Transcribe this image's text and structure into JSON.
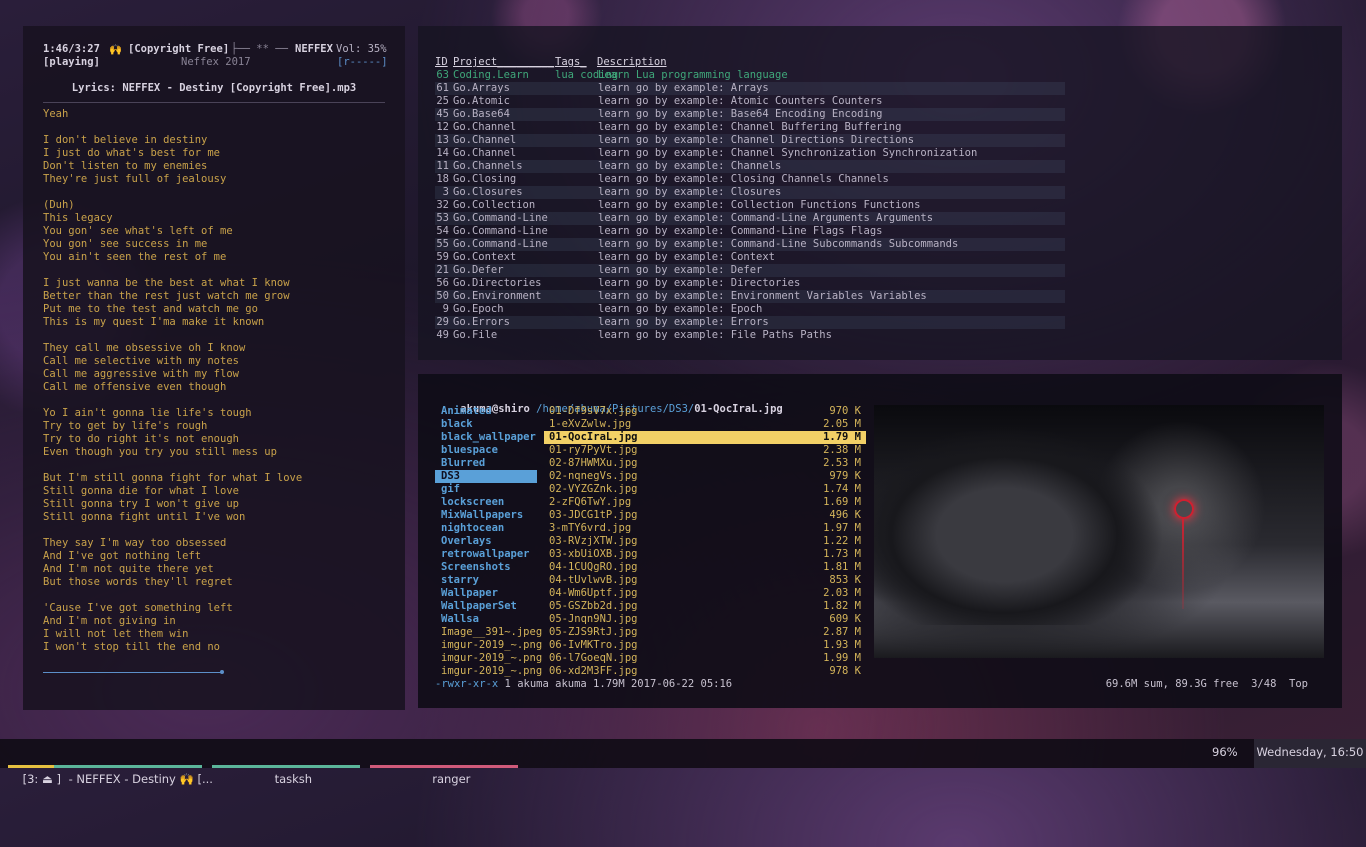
{
  "lyrics_panel": {
    "time": "1:46/3:27",
    "hands": "🙌",
    "title_short": "[Copyright Free]",
    "sep_glyphs": "├── ** ──",
    "artist": "NEFFEX",
    "volume": "Vol: 35%",
    "state": "[playing]",
    "album": "Neffex 2017",
    "flags": "[r-----]",
    "lyrics_title": "Lyrics: NEFFEX - Destiny [Copyright Free].mp3",
    "lines": [
      "Yeah",
      "",
      "I don't believe in destiny",
      "I just do what's best for me",
      "Don't listen to my enemies",
      "They're just full of jealousy",
      "",
      "(Duh)",
      "This legacy",
      "You gon' see what's left of me",
      "You gon' see success in me",
      "You ain't seen the rest of me",
      "",
      "I just wanna be the best at what I know",
      "Better than the rest just watch me grow",
      "Put me to the test and watch me go",
      "This is my quest I'ma make it known",
      "",
      "They call me obsessive oh I know",
      "Call me selective with my notes",
      "Call me aggressive with my flow",
      "Call me offensive even though",
      "",
      "Yo I ain't gonna lie life's tough",
      "Try to get by life's rough",
      "Try to do right it's not enough",
      "Even though you try you still mess up",
      "",
      "But I'm still gonna fight for what I love",
      "Still gonna die for what I love",
      "Still gonna try I won't give up",
      "Still gonna fight until I've won",
      "",
      "They say I'm way too obsessed",
      "And I've got nothing left",
      "And I'm not quite there yet",
      "But those words they'll regret",
      "",
      "'Cause I've got something left",
      "And I'm not giving in",
      "I will not let them win",
      "I won't stop till the end no"
    ]
  },
  "tasks": {
    "headers": {
      "id": "ID",
      "project": "Project",
      "tags": "Tags",
      "description": "Description"
    },
    "header_rules": {
      "project": "Project_________",
      "tags": "Tags_"
    },
    "rows": [
      {
        "id": "63",
        "project": "Coding.Learn",
        "tags": "lua coding",
        "description": "Learn Lua programming language"
      },
      {
        "id": "61",
        "project": "Go.Arrays",
        "tags": "",
        "description": "learn go by example: Arrays"
      },
      {
        "id": "25",
        "project": "Go.Atomic",
        "tags": "",
        "description": "learn go by example: Atomic Counters Counters"
      },
      {
        "id": "45",
        "project": "Go.Base64",
        "tags": "",
        "description": "learn go by example: Base64 Encoding Encoding"
      },
      {
        "id": "12",
        "project": "Go.Channel",
        "tags": "",
        "description": "learn go by example: Channel Buffering Buffering"
      },
      {
        "id": "13",
        "project": "Go.Channel",
        "tags": "",
        "description": "learn go by example: Channel Directions Directions"
      },
      {
        "id": "14",
        "project": "Go.Channel",
        "tags": "",
        "description": "learn go by example: Channel Synchronization Synchronization"
      },
      {
        "id": "11",
        "project": "Go.Channels",
        "tags": "",
        "description": "learn go by example: Channels"
      },
      {
        "id": "18",
        "project": "Go.Closing",
        "tags": "",
        "description": "learn go by example: Closing Channels Channels"
      },
      {
        "id": "3",
        "project": "Go.Closures",
        "tags": "",
        "description": "learn go by example: Closures"
      },
      {
        "id": "32",
        "project": "Go.Collection",
        "tags": "",
        "description": "learn go by example: Collection Functions Functions"
      },
      {
        "id": "53",
        "project": "Go.Command-Line",
        "tags": "",
        "description": "learn go by example: Command-Line Arguments Arguments"
      },
      {
        "id": "54",
        "project": "Go.Command-Line",
        "tags": "",
        "description": "learn go by example: Command-Line Flags Flags"
      },
      {
        "id": "55",
        "project": "Go.Command-Line",
        "tags": "",
        "description": "learn go by example: Command-Line Subcommands Subcommands"
      },
      {
        "id": "59",
        "project": "Go.Context",
        "tags": "",
        "description": "learn go by example: Context"
      },
      {
        "id": "21",
        "project": "Go.Defer",
        "tags": "",
        "description": "learn go by example: Defer"
      },
      {
        "id": "56",
        "project": "Go.Directories",
        "tags": "",
        "description": "learn go by example: Directories"
      },
      {
        "id": "50",
        "project": "Go.Environment",
        "tags": "",
        "description": "learn go by example: Environment Variables Variables"
      },
      {
        "id": "9",
        "project": "Go.Epoch",
        "tags": "",
        "description": "learn go by example: Epoch"
      },
      {
        "id": "29",
        "project": "Go.Errors",
        "tags": "",
        "description": "learn go by example: Errors"
      },
      {
        "id": "49",
        "project": "Go.File",
        "tags": "",
        "description": "learn go by example: File Paths Paths"
      }
    ]
  },
  "ranger": {
    "user": "akuma@shiro",
    "path": "/home/akuma/Pictures/DS3/",
    "current_file": "01-QocIraL.jpg",
    "dirs": [
      {
        "name": "Animated",
        "type": "dir"
      },
      {
        "name": "black",
        "type": "dir"
      },
      {
        "name": "black_wallpaper",
        "type": "dir"
      },
      {
        "name": "bluespace",
        "type": "dir"
      },
      {
        "name": "Blurred",
        "type": "dir"
      },
      {
        "name": "DS3",
        "type": "dir",
        "selected": true
      },
      {
        "name": "gif",
        "type": "dir"
      },
      {
        "name": "lockscreen",
        "type": "dir"
      },
      {
        "name": "MixWallpapers",
        "type": "dir"
      },
      {
        "name": "nightocean",
        "type": "dir"
      },
      {
        "name": "Overlays",
        "type": "dir"
      },
      {
        "name": "retrowallpaper",
        "type": "dir"
      },
      {
        "name": "Screenshots",
        "type": "dir"
      },
      {
        "name": "starry",
        "type": "dir"
      },
      {
        "name": "Wallpaper",
        "type": "dir"
      },
      {
        "name": "WallpaperSet",
        "type": "dir"
      },
      {
        "name": "Wallsa",
        "type": "dir"
      },
      {
        "name": "Image__391~.jpeg",
        "type": "file"
      },
      {
        "name": "imgur-2019_~.png",
        "type": "file"
      },
      {
        "name": "imgur-2019_~.png",
        "type": "file"
      },
      {
        "name": "imgur-2019_~.png",
        "type": "file"
      }
    ],
    "files": [
      {
        "name": "01-Df9sV7x.jpg",
        "size": "970 K"
      },
      {
        "name": "1-eXvZwlw.jpg",
        "size": "2.05 M"
      },
      {
        "name": "01-QocIraL.jpg",
        "size": "1.79 M",
        "selected": true
      },
      {
        "name": "01-ry7PyVt.jpg",
        "size": "2.38 M"
      },
      {
        "name": "02-87HWMXu.jpg",
        "size": "2.53 M"
      },
      {
        "name": "02-nqnegVs.jpg",
        "size": "979 K"
      },
      {
        "name": "02-VYZGZnk.jpg",
        "size": "1.74 M"
      },
      {
        "name": "2-zFQ6TwY.jpg",
        "size": "1.69 M"
      },
      {
        "name": "03-JDCG1tP.jpg",
        "size": "496 K"
      },
      {
        "name": "3-mTY6vrd.jpg",
        "size": "1.97 M"
      },
      {
        "name": "03-RVzjXTW.jpg",
        "size": "1.22 M"
      },
      {
        "name": "03-xbUiOXB.jpg",
        "size": "1.73 M"
      },
      {
        "name": "04-1CUQgRO.jpg",
        "size": "1.81 M"
      },
      {
        "name": "04-tUvlwvB.jpg",
        "size": "853 K"
      },
      {
        "name": "04-Wm6Uptf.jpg",
        "size": "2.03 M"
      },
      {
        "name": "05-GSZbb2d.jpg",
        "size": "1.82 M"
      },
      {
        "name": "05-Jnqn9NJ.jpg",
        "size": "609 K"
      },
      {
        "name": "05-ZJS9RtJ.jpg",
        "size": "2.87 M"
      },
      {
        "name": "06-IvMKTro.jpg",
        "size": "1.93 M"
      },
      {
        "name": "06-l7GoeqN.jpg",
        "size": "1.99 M"
      },
      {
        "name": "06-xd2M3FF.jpg",
        "size": "978 K"
      }
    ],
    "status_perm": "-rwxr-xr-x",
    "status_info": "1 akuma akuma 1.79M 2017-06-22 05:16",
    "status_right": "69.6M sum, 89.3G free  3/48  Top"
  },
  "bar": {
    "workspace": "[3: ⏏ ]",
    "win1": "- NEFFEX - Destiny 🙌 [...",
    "win2": "tasksh",
    "win3": "ranger",
    "battery": "96%",
    "datetime": "Wednesday, 16:50",
    "colors": {
      "win1": "#5bb59a",
      "win2": "#5bb59a",
      "win3": "#d05a7a",
      "workspace": "#e6c040"
    }
  }
}
